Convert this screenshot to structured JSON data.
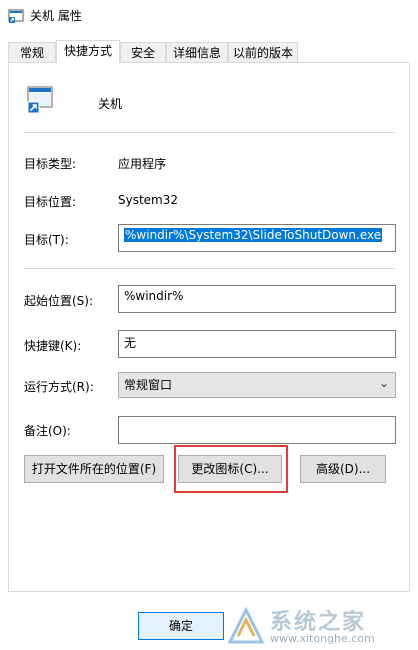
{
  "window": {
    "title": "关机 属性"
  },
  "tabs": [
    {
      "label": "常规",
      "active": false
    },
    {
      "label": "快捷方式",
      "active": true
    },
    {
      "label": "安全",
      "active": false
    },
    {
      "label": "详细信息",
      "active": false
    },
    {
      "label": "以前的版本",
      "active": false
    }
  ],
  "shortcut": {
    "name": "关机",
    "target_type_label": "目标类型:",
    "target_type_value": "应用程序",
    "target_location_label": "目标位置:",
    "target_location_value": "System32",
    "target_label": "目标(T):",
    "target_value": "%windir%\\System32\\SlideToShutDown.exe",
    "start_in_label": "起始位置(S):",
    "start_in_value": "%windir%",
    "hotkey_label": "快捷键(K):",
    "hotkey_value": "无",
    "run_label": "运行方式(R):",
    "run_value": "常规窗口",
    "comment_label": "备注(O):",
    "comment_value": ""
  },
  "buttons": {
    "open_location": "打开文件所在的位置(F)",
    "change_icon": "更改图标(C)...",
    "advanced": "高级(D)...",
    "ok": "确定"
  },
  "watermark": {
    "brand": "系统之家",
    "url": "www.xitonghe.com"
  },
  "colors": {
    "selection": "#0078d7",
    "highlight_box": "#e23b3b"
  }
}
